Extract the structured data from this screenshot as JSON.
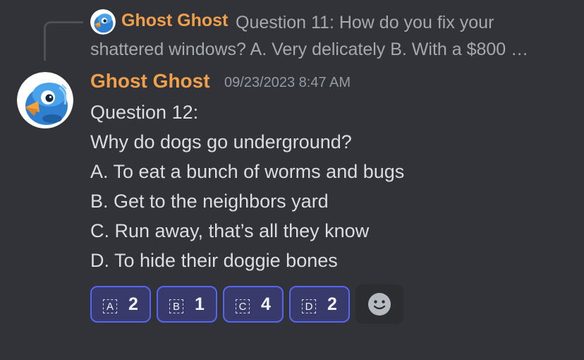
{
  "reply": {
    "author": "Ghost Ghost",
    "preview": "Question 11: How do you fix your shattered windows? A. Very delicately B. With a $800 …",
    "avatar_icon": "blue-bird-avatar"
  },
  "message": {
    "author": "Ghost Ghost",
    "timestamp": "09/23/2023 8:47 AM",
    "avatar_icon": "blue-bird-avatar",
    "lines": [
      "Question 12:",
      "Why do dogs go underground?",
      "A. To eat a bunch of worms and bugs",
      "B. Get to the neighbors yard",
      "C. Run away, that’s all they know",
      "D. To hide their doggie bones"
    ]
  },
  "reactions": [
    {
      "emoji": "A",
      "count": "2"
    },
    {
      "emoji": "B",
      "count": "1"
    },
    {
      "emoji": "C",
      "count": "4"
    },
    {
      "emoji": "D",
      "count": "2"
    }
  ],
  "add_reaction_icon": "smiley-add-reaction-icon",
  "colors": {
    "background": "#313338",
    "username": "#f0a04b",
    "reaction_border": "#5865f2",
    "reaction_bg": "#373a6b"
  }
}
